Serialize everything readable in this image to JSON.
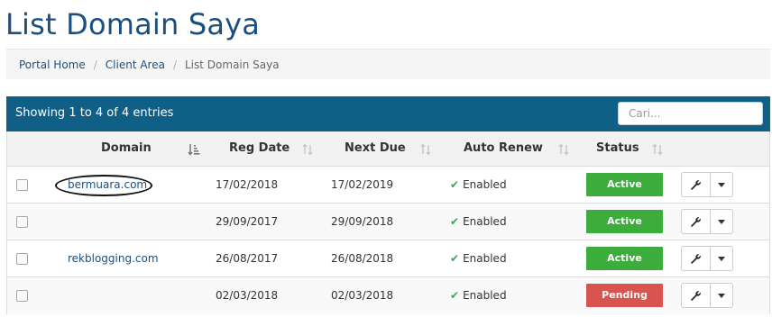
{
  "page": {
    "title": "List Domain Saya"
  },
  "breadcrumb": {
    "home": "Portal Home",
    "client_area": "Client Area",
    "current": "List Domain Saya",
    "separator": "/"
  },
  "table": {
    "info": "Showing 1 to 4 of 4 entries",
    "search_placeholder": "Cari...",
    "columns": {
      "domain": "Domain",
      "reg_date": "Reg Date",
      "next_due": "Next Due",
      "auto_renew": "Auto Renew",
      "status": "Status"
    },
    "rows": [
      {
        "domain": "bermuara.com",
        "reg_date": "17/02/2018",
        "next_due": "17/02/2019",
        "auto_renew": "Enabled",
        "status": "Active"
      },
      {
        "domain": "",
        "reg_date": "29/09/2017",
        "next_due": "29/09/2018",
        "auto_renew": "Enabled",
        "status": "Active"
      },
      {
        "domain": "rekblogging.com",
        "reg_date": "26/08/2017",
        "next_due": "26/08/2018",
        "auto_renew": "Enabled",
        "status": "Active"
      },
      {
        "domain": "",
        "reg_date": "02/03/2018",
        "next_due": "02/03/2018",
        "auto_renew": "Enabled",
        "status": "Pending"
      }
    ]
  },
  "colors": {
    "header_bg": "#0f5f86",
    "title": "#1c4f7d",
    "active": "#3cac3c",
    "pending": "#d9534f",
    "check": "#3aa655"
  },
  "icons": {
    "check": "check-icon",
    "wrench": "wrench-icon",
    "caret": "caret-down-icon",
    "sort": "sort-icon"
  }
}
